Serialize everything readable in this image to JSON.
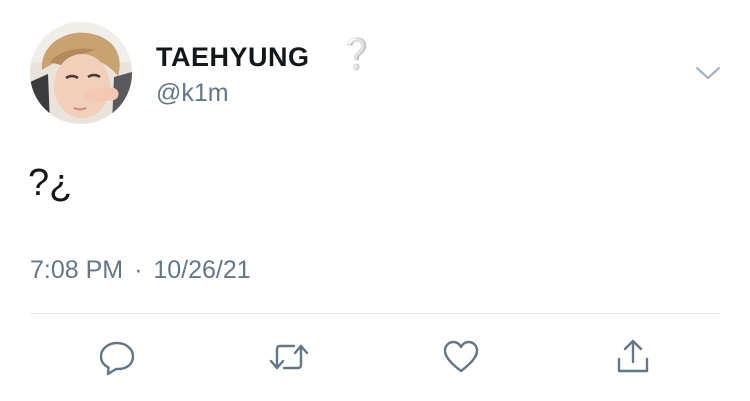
{
  "tweet": {
    "author": {
      "display_name": "TAEHYUNG",
      "name_emoji": "❔",
      "handle": "@k1m"
    },
    "text": "?¿",
    "time": "7:08 PM",
    "separator": "·",
    "date": "10/26/21"
  },
  "actions": {
    "reply_icon": "reply-icon",
    "retweet_icon": "retweet-icon",
    "like_icon": "heart-icon",
    "share_icon": "share-icon"
  },
  "colors": {
    "text_primary": "#14171a",
    "text_secondary": "#657786",
    "icon": "#657786",
    "divider": "#e1e8ed"
  }
}
